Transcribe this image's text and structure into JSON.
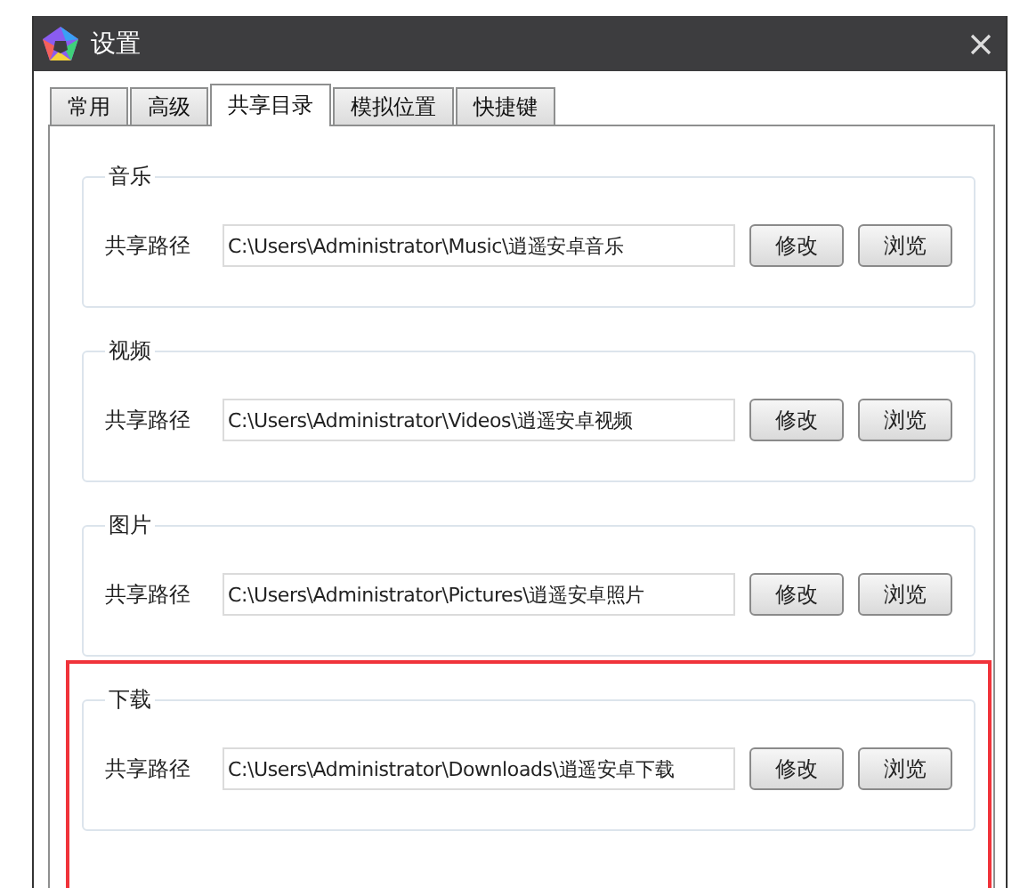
{
  "window": {
    "title": "设置"
  },
  "tabs": [
    {
      "label": "常用",
      "selected": false
    },
    {
      "label": "高级",
      "selected": false
    },
    {
      "label": "共享目录",
      "selected": true
    },
    {
      "label": "模拟位置",
      "selected": false
    },
    {
      "label": "快捷键",
      "selected": false
    }
  ],
  "groups": [
    {
      "title": "音乐",
      "label": "共享路径",
      "path": "C:\\Users\\Administrator\\Music\\逍遥安卓音乐",
      "buttons": [
        "修改",
        "浏览"
      ],
      "highlighted": false
    },
    {
      "title": "视频",
      "label": "共享路径",
      "path": "C:\\Users\\Administrator\\Videos\\逍遥安卓视频",
      "buttons": [
        "修改",
        "浏览"
      ],
      "highlighted": false
    },
    {
      "title": "图片",
      "label": "共享路径",
      "path": "C:\\Users\\Administrator\\Pictures\\逍遥安卓照片",
      "buttons": [
        "修改",
        "浏览"
      ],
      "highlighted": false
    },
    {
      "title": "下载",
      "label": "共享路径",
      "path": "C:\\Users\\Administrator\\Downloads\\逍遥安卓下载",
      "buttons": [
        "修改",
        "浏览"
      ],
      "highlighted": true
    }
  ]
}
